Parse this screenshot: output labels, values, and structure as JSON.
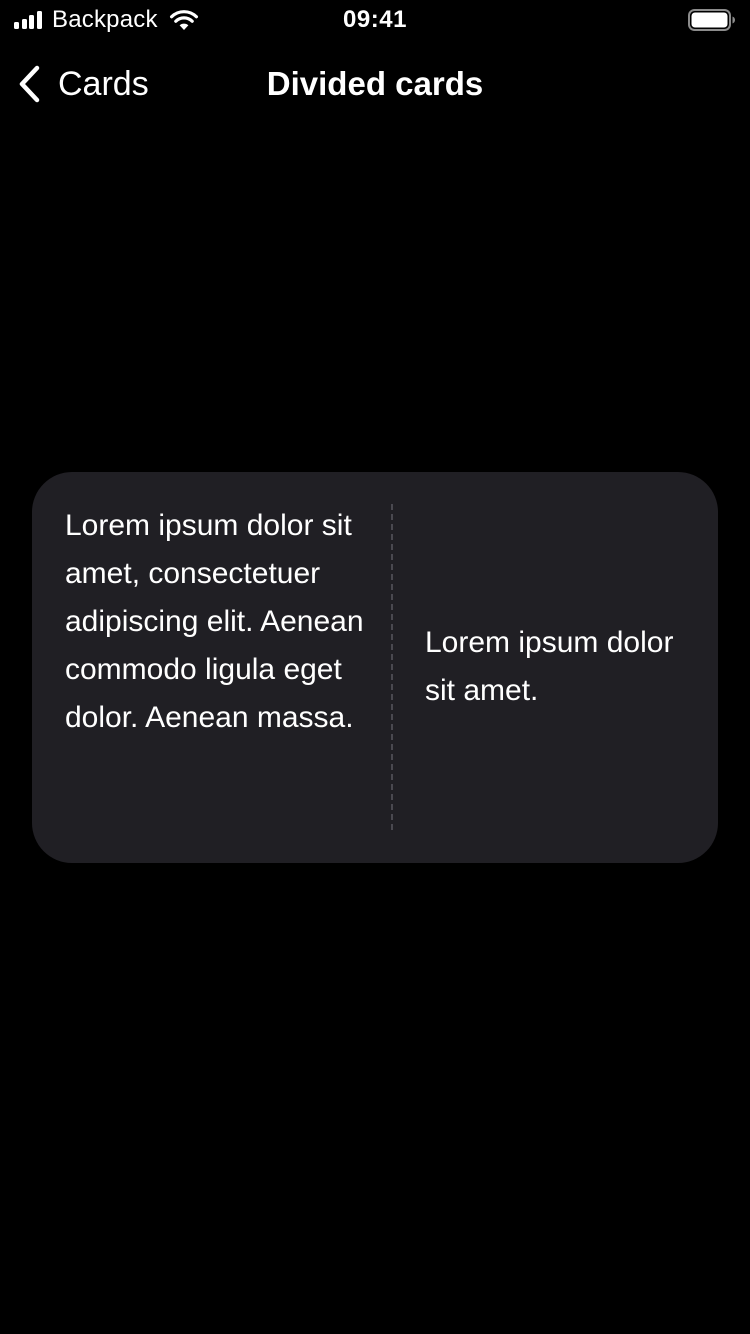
{
  "status_bar": {
    "carrier": "Backpack",
    "time": "09:41",
    "signal_icon": "signal-bars-icon",
    "wifi_icon": "wifi-icon",
    "battery_icon": "battery-full-icon",
    "battery_level": 1.0
  },
  "nav": {
    "back_label": "Cards",
    "back_icon": "chevron-left-icon",
    "title": "Divided cards"
  },
  "card": {
    "primary_text": "Lorem ipsum dolor sit amet, consectetuer adipiscing elit. Aenean commodo ligula eget dolor. Aenean massa.",
    "secondary_text": "Lorem ipsum dolor sit amet."
  },
  "colors": {
    "background": "#000000",
    "card_background": "#201f24",
    "divider": "#4a4950",
    "text": "#ffffff"
  }
}
